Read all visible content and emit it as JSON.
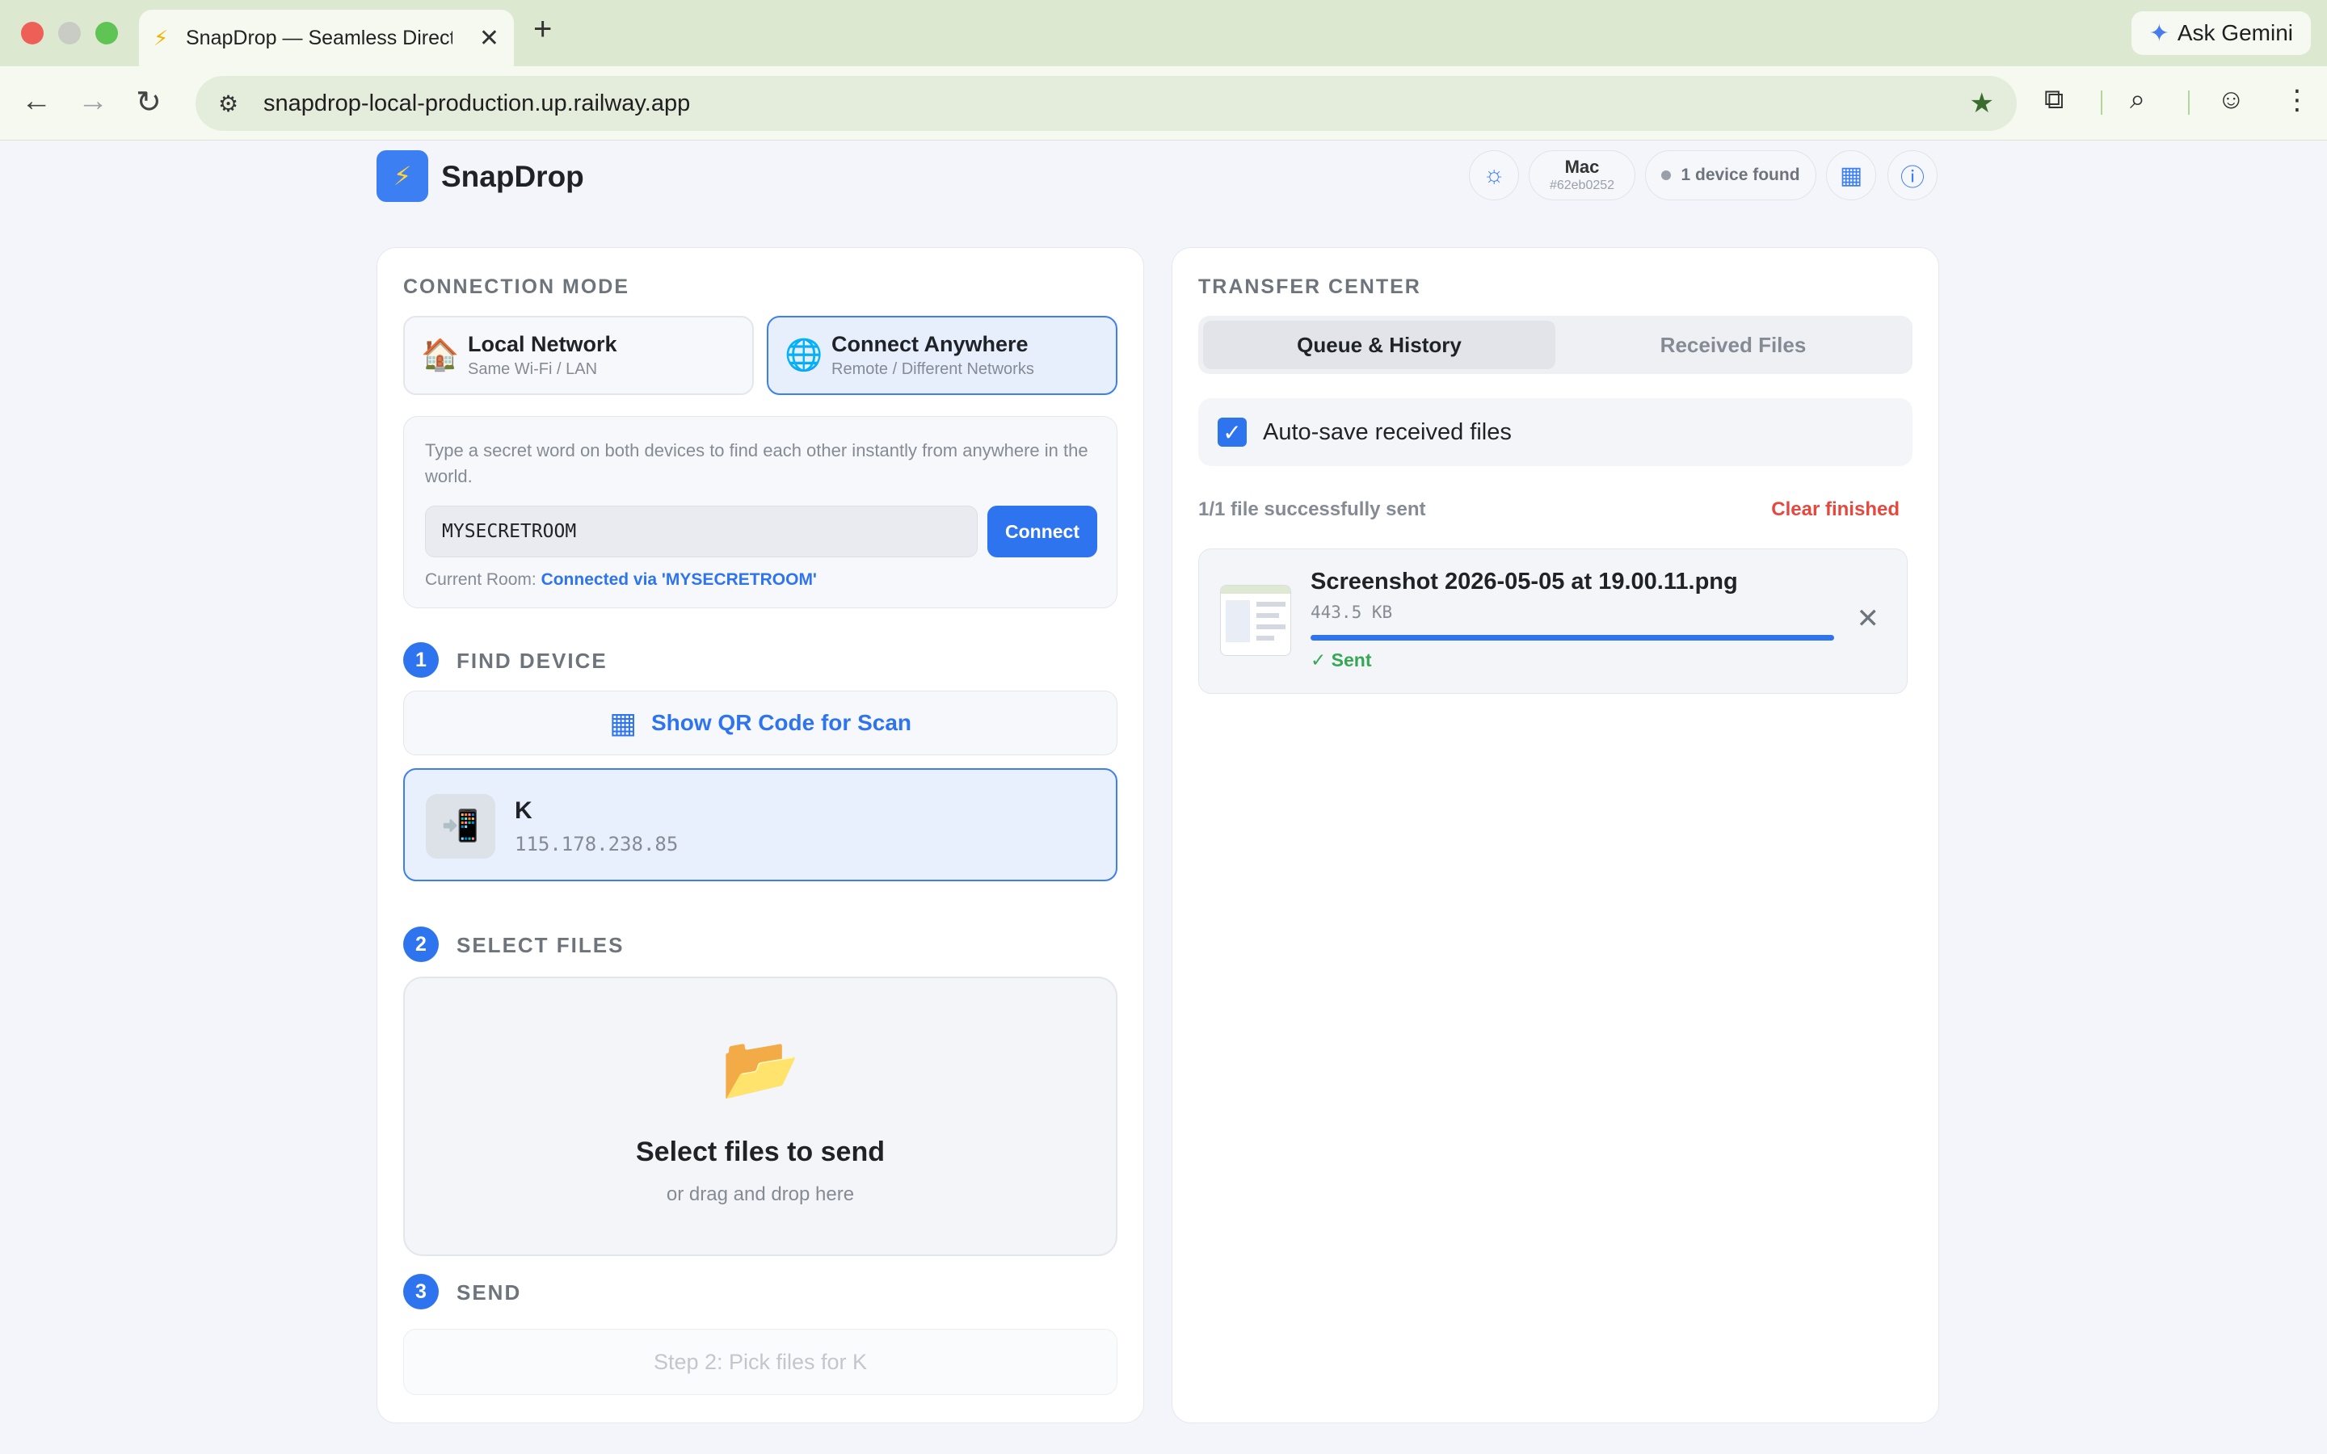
{
  "browser": {
    "tab_title": "SnapDrop — Seamless Direct",
    "tab_icon": "⚡",
    "url": "snapdrop-local-production.up.railway.app",
    "gemini_label": "Ask Gemini"
  },
  "app": {
    "name": "SnapDrop",
    "device_name": "Mac",
    "device_id": "#62eb0252",
    "devices_found": "1 device found"
  },
  "left": {
    "section_title": "CONNECTION MODE",
    "modes": [
      {
        "title": "Local Network",
        "subtitle": "Same Wi-Fi / LAN",
        "icon": "🏠"
      },
      {
        "title": "Connect Anywhere",
        "subtitle": "Remote / Different Networks",
        "icon": "🌐"
      }
    ],
    "room": {
      "description": "Type a secret word on both devices to find each other instantly from anywhere in the world.",
      "input_value": "MYSECRETROOM",
      "connect_label": "Connect",
      "status_prefix": "Current Room:",
      "status_value": "Connected via 'MYSECRETROOM'"
    },
    "steps": [
      {
        "num": "1",
        "label": "FIND DEVICE"
      },
      {
        "num": "2",
        "label": "SELECT FILES"
      },
      {
        "num": "3",
        "label": "SEND"
      }
    ],
    "qr_label": "Show QR Code for Scan",
    "device": {
      "name": "K",
      "ip": "115.178.238.85",
      "icon": "📲"
    },
    "drop": {
      "icon": "📂",
      "title": "Select files to send",
      "subtitle": "or drag and drop here"
    },
    "send_label": "Step 2: Pick files for K"
  },
  "right": {
    "section_title": "TRANSFER CENTER",
    "tabs": [
      "Queue & History",
      "Received Files"
    ],
    "autosave_label": "Auto-save received files",
    "autosave_checked": true,
    "summary": "1/1 file successfully sent",
    "clear_label": "Clear finished",
    "files": [
      {
        "name": "Screenshot 2026-05-05 at 19.00.11.png",
        "size": "443.5 KB",
        "status": "✓ Sent",
        "progress": 1.0
      }
    ]
  },
  "colors": {
    "accent": "#2f74ef",
    "danger": "#e5483e",
    "success": "#35a853"
  }
}
